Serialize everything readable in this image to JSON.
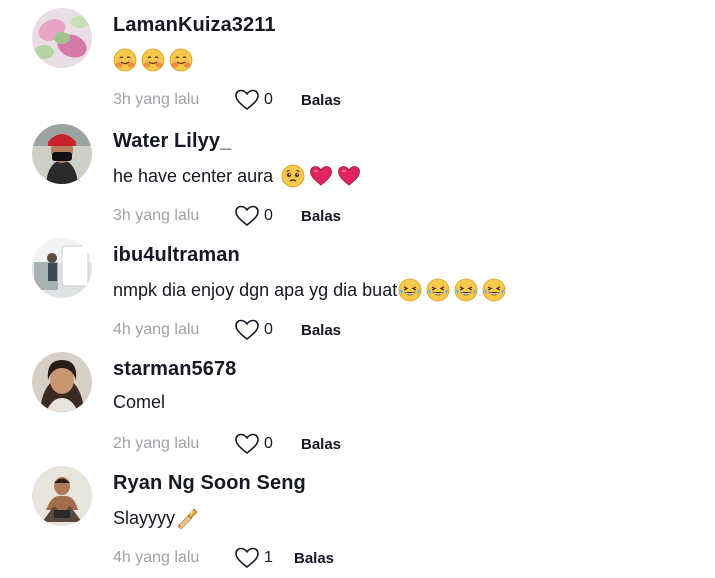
{
  "comments": [
    {
      "username": "LamanKuiza3211",
      "text": "",
      "emojis": [
        "hug-emoji",
        "hug-emoji",
        "hug-emoji"
      ],
      "time": "3h yang lalu",
      "likes": "0",
      "reply_label": "Balas"
    },
    {
      "username": "Water Lilyy_",
      "text": "he have center aura",
      "emojis": [
        "pleading-face-emoji",
        "heart-emoji",
        "heart-emoji"
      ],
      "time": "3h yang lalu",
      "likes": "0",
      "reply_label": "Balas"
    },
    {
      "username": "ibu4ultraman",
      "text": "nmpk dia enjoy dgn apa yg dia buat",
      "emojis": [
        "laughing-tears-emoji",
        "laughing-tears-emoji",
        "laughing-tears-emoji",
        "laughing-tears-emoji"
      ],
      "time": "4h yang lalu",
      "likes": "0",
      "reply_label": "Balas"
    },
    {
      "username": "starman5678",
      "text": "Comel",
      "emojis": [],
      "time": "2h yang lalu",
      "likes": "0",
      "reply_label": "Balas"
    },
    {
      "username": "Ryan Ng Soon Seng",
      "text": "Slayyyy",
      "emojis": [
        "nail-polish-emoji"
      ],
      "time": "4h yang lalu",
      "likes": "1",
      "reply_label": "Balas"
    }
  ],
  "colors": {
    "text": "#161823",
    "muted": "#a1a2a7"
  }
}
